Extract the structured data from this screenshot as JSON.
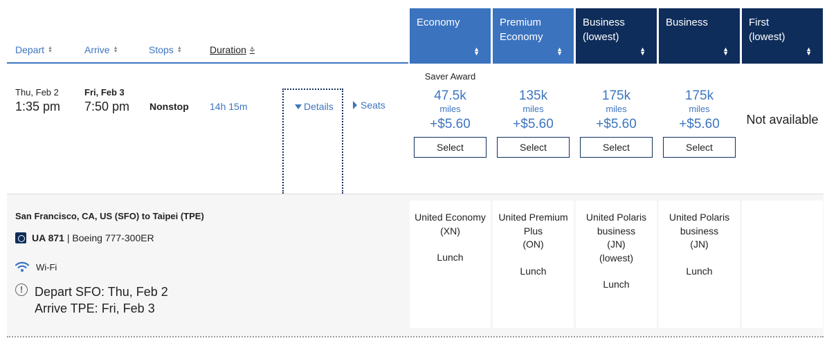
{
  "sort": {
    "depart": "Depart",
    "arrive": "Arrive",
    "stops": "Stops",
    "duration": "Duration"
  },
  "cabins": [
    {
      "name": "Economy",
      "sub": ""
    },
    {
      "name": "Premium",
      "sub": "Economy"
    },
    {
      "name": "Business",
      "sub": "(lowest)"
    },
    {
      "name": "Business",
      "sub": ""
    },
    {
      "name": "First",
      "sub": "(lowest)"
    }
  ],
  "flight": {
    "depart_date": "Thu, Feb 2",
    "depart_time": "1:35 pm",
    "arrive_date": "Fri, Feb 3",
    "arrive_time": "7:50 pm",
    "stops": "Nonstop",
    "duration": "14h 15m",
    "details_label": "Details",
    "seats_label": "Seats"
  },
  "fares": {
    "saver_label": "Saver Award",
    "miles_unit": "miles",
    "select_label": "Select",
    "items": [
      {
        "miles": "47.5k",
        "fee": "+$5.60"
      },
      {
        "miles": "135k",
        "fee": "+$5.60"
      },
      {
        "miles": "175k",
        "fee": "+$5.60"
      },
      {
        "miles": "175k",
        "fee": "+$5.60"
      }
    ],
    "not_available": "Not available"
  },
  "details": {
    "route": "San Francisco, CA, US (SFO) to Taipei (TPE)",
    "flight_number": "UA 871",
    "separator": "|",
    "aircraft": "Boeing 777-300ER",
    "wifi": "Wi-Fi",
    "depart_line": "Depart SFO: Thu, Feb 2",
    "arrive_line": "Arrive TPE: Fri, Feb 3",
    "cabins": [
      {
        "lines": [
          "United Economy",
          "(XN)"
        ],
        "meal": "Lunch"
      },
      {
        "lines": [
          "United Premium",
          "Plus",
          "(ON)"
        ],
        "meal": "Lunch"
      },
      {
        "lines": [
          "United Polaris",
          "business",
          "(JN)",
          "(lowest)"
        ],
        "meal": "Lunch"
      },
      {
        "lines": [
          "United Polaris",
          "business",
          "(JN)"
        ],
        "meal": "Lunch"
      }
    ]
  },
  "colors": {
    "accent": "#3b73bf",
    "dark": "#0f2d5a"
  }
}
